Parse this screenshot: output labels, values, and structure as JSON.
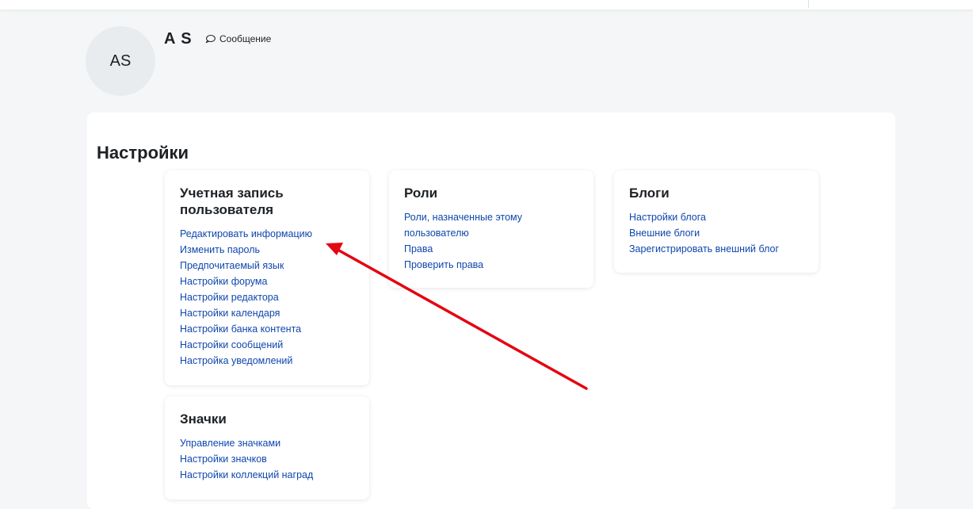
{
  "profile": {
    "avatar_initials": "AS",
    "name": "A S",
    "message_label": "Сообщение"
  },
  "page": {
    "heading": "Настройки"
  },
  "sections": {
    "account": {
      "title": "Учетная запись пользователя",
      "links": [
        "Редактировать информацию",
        "Изменить пароль",
        "Предпочитаемый язык",
        "Настройки форума",
        "Настройки редактора",
        "Настройки календаря",
        "Настройки банка контента",
        "Настройки сообщений",
        "Настройка уведомлений"
      ]
    },
    "roles": {
      "title": "Роли",
      "links": [
        "Роли, назначенные этому пользователю",
        "Права",
        "Проверить права"
      ]
    },
    "blogs": {
      "title": "Блоги",
      "links": [
        "Настройки блога",
        "Внешние блоги",
        "Зарегистрировать внешний блог"
      ]
    },
    "badges": {
      "title": "Значки",
      "links": [
        "Управление значками",
        "Настройки значков",
        "Настройки коллекций наград"
      ]
    }
  },
  "colors": {
    "link": "#0f47ad",
    "annotation_arrow": "#e30613",
    "background": "#f5f6f7",
    "card": "#ffffff"
  },
  "icons": {
    "message": "speech-bubble-icon",
    "annotation": "red-arrow-annotation"
  }
}
